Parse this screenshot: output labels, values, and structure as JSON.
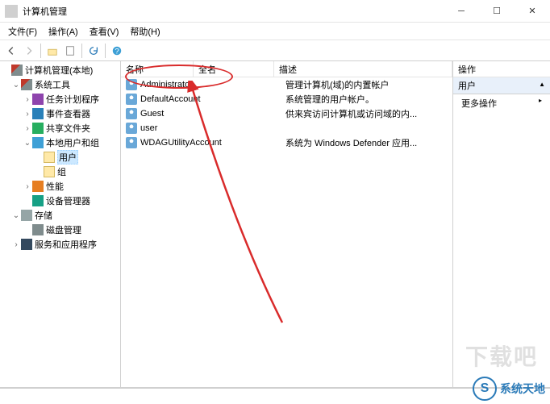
{
  "window": {
    "title": "计算机管理"
  },
  "menu": {
    "file": "文件(F)",
    "action": "操作(A)",
    "view": "查看(V)",
    "help": "帮助(H)"
  },
  "tree": {
    "root": "计算机管理(本地)",
    "systools": "系统工具",
    "task": "任务计划程序",
    "event": "事件查看器",
    "shared": "共享文件夹",
    "localusers": "本地用户和组",
    "users": "用户",
    "groups": "组",
    "perf": "性能",
    "devmgr": "设备管理器",
    "storage": "存储",
    "diskmgr": "磁盘管理",
    "services": "服务和应用程序"
  },
  "list": {
    "col_name": "名称",
    "col_fullname": "全名",
    "col_desc": "描述",
    "rows": [
      {
        "name": "Administrator",
        "desc": "管理计算机(域)的内置帐户"
      },
      {
        "name": "DefaultAccount",
        "desc": "系统管理的用户帐户。"
      },
      {
        "name": "Guest",
        "desc": "供来宾访问计算机或访问域的内..."
      },
      {
        "name": "user",
        "desc": ""
      },
      {
        "name": "WDAGUtilityAccount",
        "desc": "系统为 Windows Defender 应用..."
      }
    ]
  },
  "actions": {
    "header": "操作",
    "label": "用户",
    "more": "更多操作"
  },
  "branding": {
    "watermark": "下载吧",
    "site": "系统天地"
  }
}
